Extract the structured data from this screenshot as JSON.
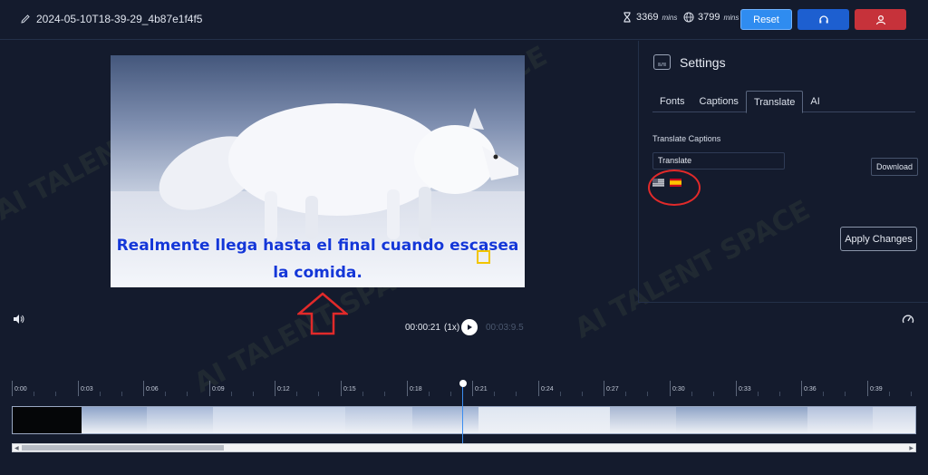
{
  "header": {
    "file_name": "2024-05-10T18-39-29_4b87e1f4f5",
    "quota_1_value": "3369",
    "quota_1_unit": "mins",
    "quota_2_value": "3799",
    "quota_2_unit": "mins",
    "reset_label": "Reset"
  },
  "video": {
    "caption_line_1": "Realmente llega hasta el final cuando escasea",
    "caption_line_2": "la comida."
  },
  "settings": {
    "title": "Settings",
    "tabs": [
      {
        "label": "Fonts"
      },
      {
        "label": "Captions"
      },
      {
        "label": "Translate"
      },
      {
        "label": "AI"
      }
    ],
    "active_tab": "Translate",
    "translate_label": "Translate Captions",
    "translate_select_value": "Translate",
    "flags": [
      "us-flag",
      "es-flag"
    ],
    "download_label": "Download",
    "apply_label": "Apply Changes"
  },
  "playback": {
    "current_time": "00:00:21",
    "speed": "(1x)",
    "total_time": "00:03:9.5"
  },
  "timeline": {
    "ticks": [
      "0:00",
      "0:03",
      "0:06",
      "0:09",
      "0:12",
      "0:15",
      "0:18",
      "0:21",
      "0:24",
      "0:27",
      "0:30",
      "0:33",
      "0:36",
      "0:39"
    ],
    "playhead_time": "0:21"
  },
  "watermark": "AI TALENT SPACE",
  "colors": {
    "background": "#141b2d",
    "reset_button": "#2f8cf0",
    "support_button": "#1d5fd0",
    "user_button": "#c6323a",
    "caption_text": "#1437d8",
    "annotation_red": "#e12a2a",
    "playhead": "#3b8df0"
  },
  "icons": {
    "edit": "pencil-icon",
    "quota_1": "hourglass-icon",
    "quota_2": "globe-icon",
    "support": "headset-icon",
    "user": "user-icon",
    "settings": "subtitles-icon",
    "volume": "volume-icon",
    "play": "play-icon",
    "speed": "speedometer-icon"
  }
}
